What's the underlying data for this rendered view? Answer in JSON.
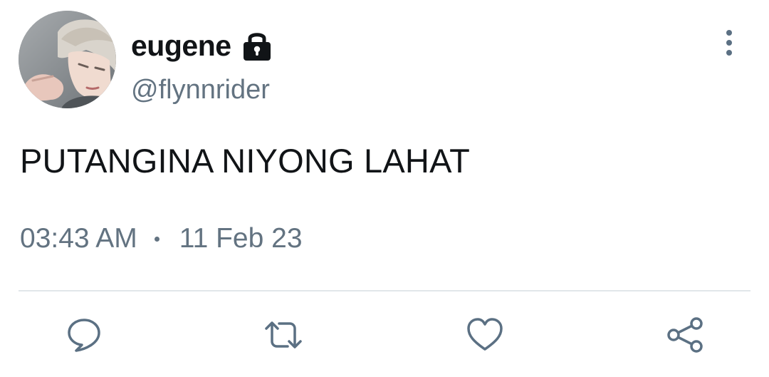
{
  "tweet": {
    "author": {
      "display_name": "eugene",
      "handle": "@flynnrider",
      "protected_icon": "lock-icon",
      "avatar": "profile-photo"
    },
    "text": "PUTANGINA NIYONG LAHAT",
    "time": "03:43 AM",
    "date": "11 Feb 23",
    "menu_icon": "more-vertical-icon"
  },
  "actions": {
    "reply_icon": "reply-icon",
    "retweet_icon": "retweet-icon",
    "like_icon": "heart-icon",
    "share_icon": "share-icon"
  },
  "colors": {
    "primary_text": "#111417",
    "secondary_text": "#637381",
    "divider": "#e1e6ea",
    "icon": "#5b7083"
  }
}
